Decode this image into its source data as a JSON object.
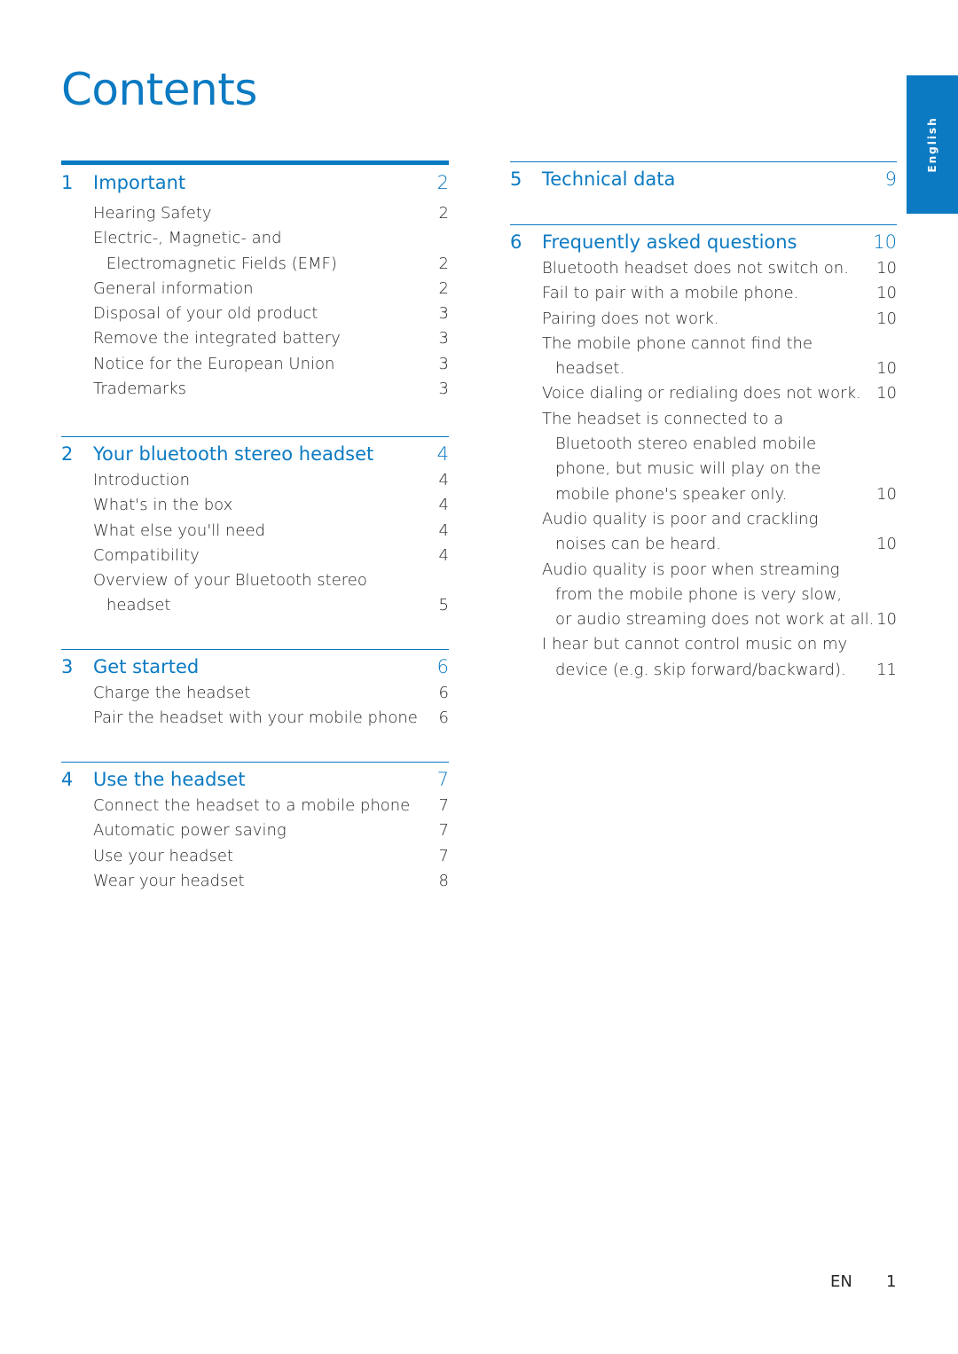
{
  "page_title": "Contents",
  "language_tab": "English",
  "colors": {
    "accent": "#0b7ac2",
    "text": "#231f20"
  },
  "left_sections": [
    {
      "number": "1",
      "title": "Important",
      "page": "2",
      "entries": [
        {
          "lines": [
            "Hearing Safety"
          ],
          "page": "2"
        },
        {
          "lines": [
            "Electric-, Magnetic- and",
            "Electromagnetic Fields (EMF)"
          ],
          "page": "2"
        },
        {
          "lines": [
            "General information"
          ],
          "page": "2"
        },
        {
          "lines": [
            "Disposal of your old product"
          ],
          "page": "3"
        },
        {
          "lines": [
            "Remove the integrated battery"
          ],
          "page": "3"
        },
        {
          "lines": [
            "Notice for the European Union"
          ],
          "page": "3"
        },
        {
          "lines": [
            "Trademarks"
          ],
          "page": "3"
        }
      ]
    },
    {
      "number": "2",
      "title": "Your bluetooth stereo headset",
      "page": "4",
      "entries": [
        {
          "lines": [
            "Introduction"
          ],
          "page": "4"
        },
        {
          "lines": [
            "What's in the box"
          ],
          "page": "4"
        },
        {
          "lines": [
            "What else you'll need"
          ],
          "page": "4"
        },
        {
          "lines": [
            "Compatibility"
          ],
          "page": "4"
        },
        {
          "lines": [
            "Overview of your Bluetooth stereo",
            "headset"
          ],
          "page": "5"
        }
      ]
    },
    {
      "number": "3",
      "title": "Get started",
      "page": "6",
      "entries": [
        {
          "lines": [
            "Charge the headset"
          ],
          "page": "6"
        },
        {
          "lines": [
            "Pair the headset with your mobile phone"
          ],
          "page": "6"
        }
      ]
    },
    {
      "number": "4",
      "title": "Use the headset",
      "page": "7",
      "entries": [
        {
          "lines": [
            "Connect the headset to a mobile phone"
          ],
          "page": "7"
        },
        {
          "lines": [
            "Automatic power saving"
          ],
          "page": "7"
        },
        {
          "lines": [
            "Use your headset"
          ],
          "page": "7"
        },
        {
          "lines": [
            "Wear your headset"
          ],
          "page": "8"
        }
      ]
    }
  ],
  "right_sections": [
    {
      "number": "5",
      "title": "Technical data",
      "page": "9",
      "entries": []
    },
    {
      "number": "6",
      "title": "Frequently asked questions",
      "page": "10",
      "entries": [
        {
          "lines": [
            "Bluetooth headset does not switch on."
          ],
          "page": "10"
        },
        {
          "lines": [
            "Fail to pair with a mobile phone."
          ],
          "page": "10"
        },
        {
          "lines": [
            "Pairing does not work."
          ],
          "page": "10"
        },
        {
          "lines": [
            "The mobile phone cannot find the",
            "headset."
          ],
          "page": "10"
        },
        {
          "lines": [
            "Voice dialing or redialing does not work."
          ],
          "page": "10"
        },
        {
          "lines": [
            "The headset is connected to a",
            "Bluetooth stereo enabled mobile",
            "phone, but music will play on the",
            "mobile phone's speaker only."
          ],
          "page": "10"
        },
        {
          "lines": [
            "Audio quality is poor and crackling",
            "noises can be heard."
          ],
          "page": "10"
        },
        {
          "lines": [
            "Audio quality is poor when streaming",
            "from the mobile phone is very slow,",
            "or audio streaming does not work at all."
          ],
          "page": "10"
        },
        {
          "lines": [
            "I hear but cannot control music on my",
            "device (e.g. skip forward/backward)."
          ],
          "page": "11"
        }
      ]
    }
  ],
  "footer": {
    "language": "EN",
    "page_number": "1"
  }
}
